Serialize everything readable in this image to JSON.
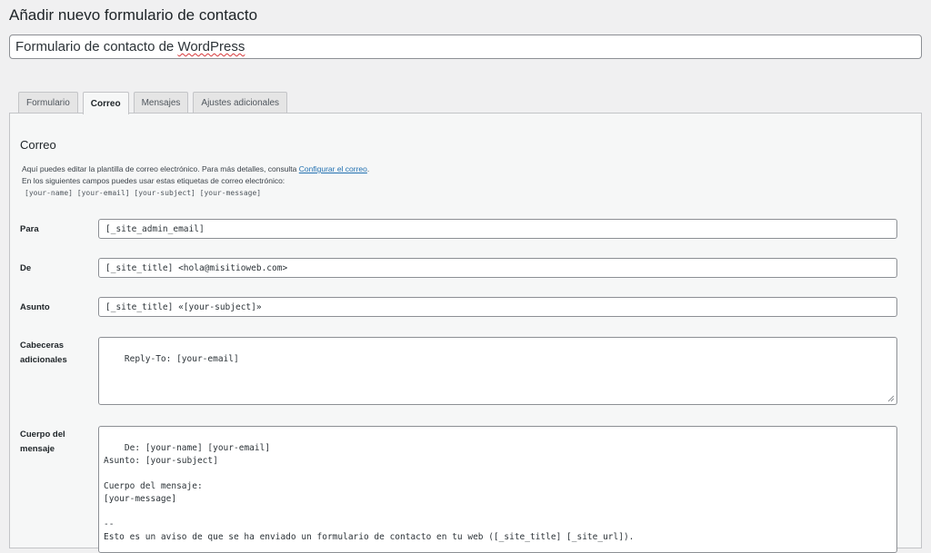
{
  "page": {
    "title": "Añadir nuevo formulario de contacto",
    "form_title_value_a": "Formulario de contacto de ",
    "form_title_value_b": "WordPress"
  },
  "tabs": [
    {
      "label": "Formulario",
      "active": false
    },
    {
      "label": "Correo",
      "active": true
    },
    {
      "label": "Mensajes",
      "active": false
    },
    {
      "label": "Ajustes adicionales",
      "active": false
    }
  ],
  "mail": {
    "section_title": "Correo",
    "desc_line1": "Aquí puedes editar la plantilla de correo electrónico. Para más detalles, consulta ",
    "desc_link": "Configurar el correo",
    "desc_line1_end": ".",
    "desc_line2": "En los siguientes campos puedes usar estas etiquetas de correo electrónico:",
    "tags": "[your-name] [your-email] [your-subject] [your-message]",
    "fields": {
      "to_label": "Para",
      "to_value": "[_site_admin_email]",
      "from_label": "De",
      "from_value": "[_site_title] <hola@misitioweb.com>",
      "subject_label": "Asunto",
      "subject_value": "[_site_title] «[your-subject]»",
      "headers_label_1": "Cabeceras",
      "headers_label_2": "adicionales",
      "headers_value": "Reply-To: [your-email]",
      "body_label_1": "Cuerpo del",
      "body_label_2": "mensaje",
      "body_value": "De: [your-name] [your-email]\nAsunto: [your-subject]\n\nCuerpo del mensaje:\n[your-message]\n\n--\nEsto es un aviso de que se ha enviado un formulario de contacto en tu web ([_site_title] [_site_url])."
    }
  },
  "colors": {
    "link": "#2271b1",
    "background": "#f0f0f1",
    "border": "#8c8f94"
  }
}
